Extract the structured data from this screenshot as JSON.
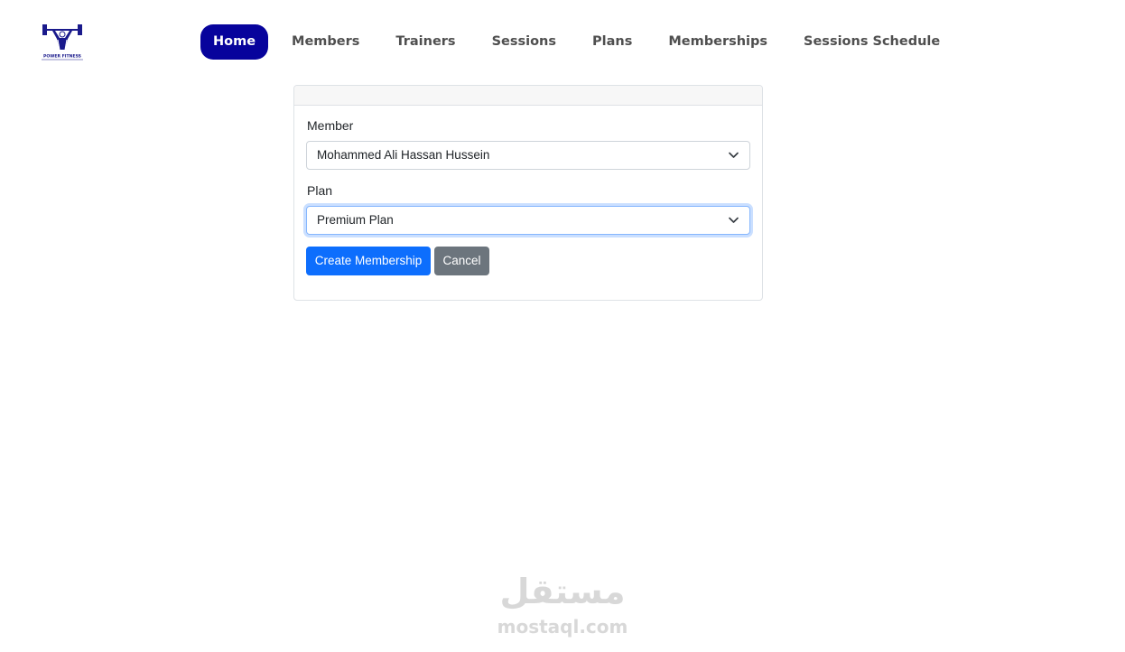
{
  "logo": {
    "icon": "weightlifter-logo-icon",
    "text": "POWER FITNESS"
  },
  "nav": {
    "items": [
      {
        "label": "Home",
        "active": true
      },
      {
        "label": "Members",
        "active": false
      },
      {
        "label": "Trainers",
        "active": false
      },
      {
        "label": "Sessions",
        "active": false
      },
      {
        "label": "Plans",
        "active": false
      },
      {
        "label": "Memberships",
        "active": false
      },
      {
        "label": "Sessions Schedule",
        "active": false
      }
    ],
    "active_color": "#07039c"
  },
  "form": {
    "member_label": "Member",
    "member_value": "Mohammed Ali Hassan Hussein",
    "plan_label": "Plan",
    "plan_value": "Premium Plan",
    "create_button": "Create Membership",
    "cancel_button": "Cancel"
  },
  "colors": {
    "primary": "#0d6efd",
    "secondary": "#6c757d"
  },
  "watermark": {
    "arabic": "مستقل",
    "latin": "mostaql.com"
  }
}
